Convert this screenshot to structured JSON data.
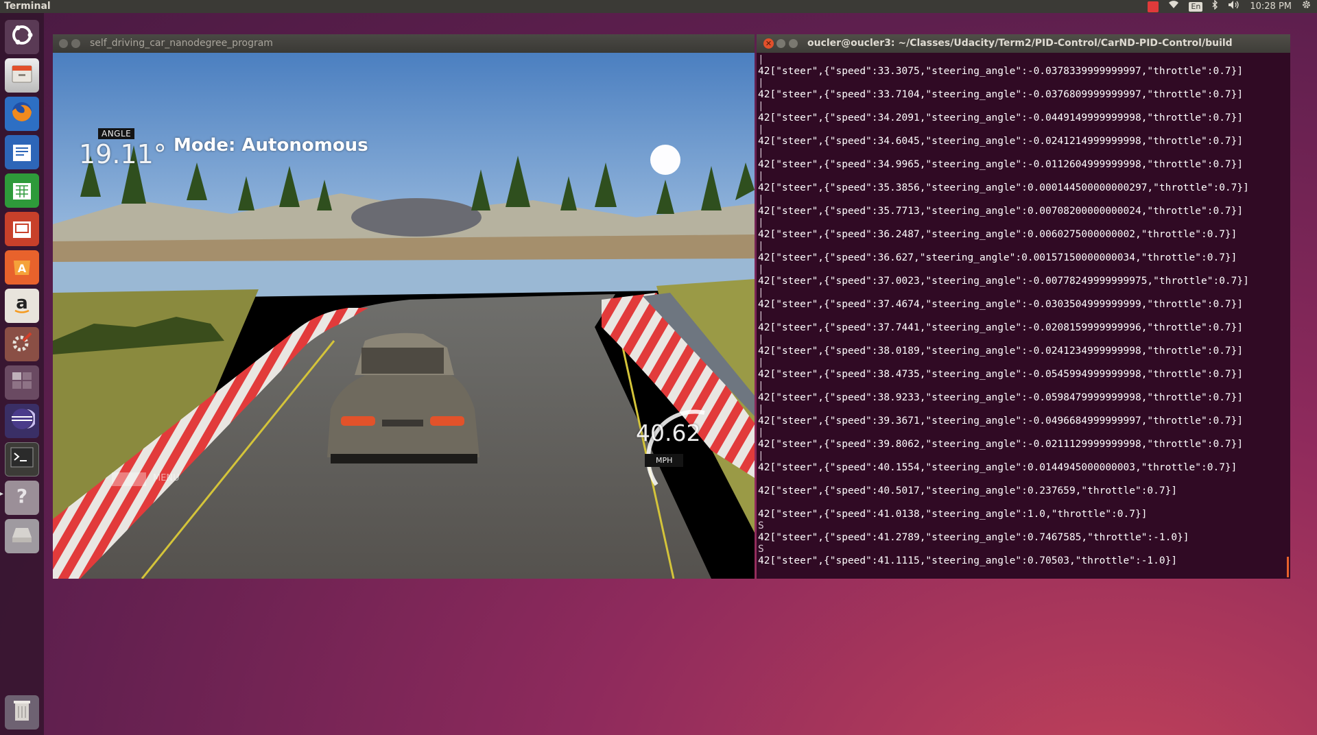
{
  "top_panel": {
    "active_app": "Terminal",
    "keyboard_layout": "En",
    "clock": "10:28 PM"
  },
  "launcher": {
    "items": [
      {
        "name": "ubuntu-dash",
        "icon": "ubuntu-logo-icon"
      },
      {
        "name": "files",
        "icon": "file-cabinet-icon"
      },
      {
        "name": "firefox",
        "icon": "firefox-icon"
      },
      {
        "name": "libreoffice-writer",
        "icon": "writer-icon"
      },
      {
        "name": "libreoffice-calc",
        "icon": "calc-icon"
      },
      {
        "name": "libreoffice-impress",
        "icon": "impress-icon"
      },
      {
        "name": "software-center",
        "icon": "shopping-bag-icon"
      },
      {
        "name": "amazon",
        "icon": "amazon-icon"
      },
      {
        "name": "system-settings",
        "icon": "gear-wrench-icon"
      },
      {
        "name": "workspace-switcher",
        "icon": "workspace-icon"
      },
      {
        "name": "eclipse",
        "icon": "eclipse-icon"
      },
      {
        "name": "terminal",
        "icon": "terminal-icon"
      },
      {
        "name": "help",
        "icon": "question-icon"
      },
      {
        "name": "drive",
        "icon": "drive-icon"
      },
      {
        "name": "trash",
        "icon": "trash-icon"
      }
    ]
  },
  "simulator": {
    "window_title": "self_driving_car_nanodegree_program",
    "angle_badge": "ANGLE",
    "angle_value": "19.11°",
    "mode_label": "Mode: Autonomous",
    "speed_value": "40.62",
    "speed_unit": "MPH",
    "menu_label": "MENU"
  },
  "terminal": {
    "window_title": "oucler@oucler3: ~/Classes/Udacity/Term2/PID-Control/CarND-PID-Control/build",
    "lines": [
      "|",
      "42[\"steer\",{\"speed\":33.3075,\"steering_angle\":-0.0378339999999997,\"throttle\":0.7}]",
      "|",
      "42[\"steer\",{\"speed\":33.7104,\"steering_angle\":-0.0376809999999997,\"throttle\":0.7}]",
      "|",
      "42[\"steer\",{\"speed\":34.2091,\"steering_angle\":-0.0449149999999998,\"throttle\":0.7}]",
      "|",
      "42[\"steer\",{\"speed\":34.6045,\"steering_angle\":-0.0241214999999998,\"throttle\":0.7}]",
      "|",
      "42[\"steer\",{\"speed\":34.9965,\"steering_angle\":-0.0112604999999998,\"throttle\":0.7}]",
      "|",
      "42[\"steer\",{\"speed\":35.3856,\"steering_angle\":0.000144500000000297,\"throttle\":0.7}]",
      "|",
      "42[\"steer\",{\"speed\":35.7713,\"steering_angle\":0.00708200000000024,\"throttle\":0.7}]",
      "|",
      "42[\"steer\",{\"speed\":36.2487,\"steering_angle\":0.0060275000000002,\"throttle\":0.7}]",
      "|",
      "42[\"steer\",{\"speed\":36.627,\"steering_angle\":0.00157150000000034,\"throttle\":0.7}]",
      "|",
      "42[\"steer\",{\"speed\":37.0023,\"steering_angle\":-0.00778249999999975,\"throttle\":0.7}]",
      "|",
      "42[\"steer\",{\"speed\":37.4674,\"steering_angle\":-0.0303504999999999,\"throttle\":0.7}]",
      "|",
      "42[\"steer\",{\"speed\":37.7441,\"steering_angle\":-0.0208159999999996,\"throttle\":0.7}]",
      "|",
      "42[\"steer\",{\"speed\":38.0189,\"steering_angle\":-0.0241234999999998,\"throttle\":0.7}]",
      "|",
      "42[\"steer\",{\"speed\":38.4735,\"steering_angle\":-0.0545994999999998,\"throttle\":0.7}]",
      "|",
      "42[\"steer\",{\"speed\":38.9233,\"steering_angle\":-0.0598479999999998,\"throttle\":0.7}]",
      "|",
      "42[\"steer\",{\"speed\":39.3671,\"steering_angle\":-0.0496684999999997,\"throttle\":0.7}]",
      "|",
      "42[\"steer\",{\"speed\":39.8062,\"steering_angle\":-0.0211129999999998,\"throttle\":0.7}]",
      "|",
      "42[\"steer\",{\"speed\":40.1554,\"steering_angle\":0.0144945000000003,\"throttle\":0.7}]",
      "",
      "42[\"steer\",{\"speed\":40.5017,\"steering_angle\":0.237659,\"throttle\":0.7}]",
      "",
      "42[\"steer\",{\"speed\":41.0138,\"steering_angle\":1.0,\"throttle\":0.7}]",
      "S",
      "42[\"steer\",{\"speed\":41.2789,\"steering_angle\":0.7467585,\"throttle\":-1.0}]",
      "S",
      "42[\"steer\",{\"speed\":41.1115,\"steering_angle\":0.70503,\"throttle\":-1.0}]"
    ]
  },
  "colors": {
    "terminal_bg": "#300a24",
    "panel_bg": "#3b3a36",
    "close_button": "#e2502b"
  }
}
